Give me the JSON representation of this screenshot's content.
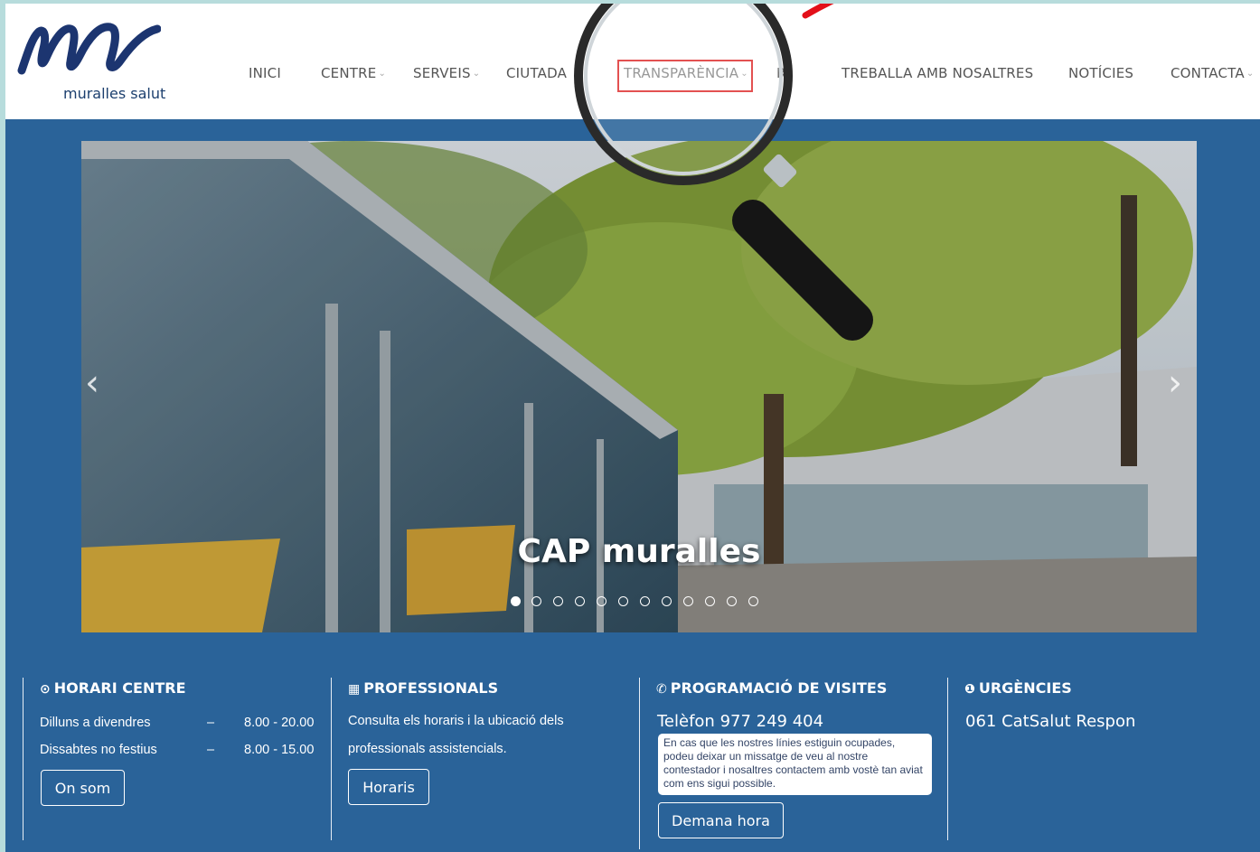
{
  "brand": {
    "logo_text": "muralles salut",
    "accent": "#2a6399",
    "highlight": "#e03a3a"
  },
  "nav": {
    "items": [
      {
        "label": "INICI",
        "caret": false
      },
      {
        "label": "CENTRE",
        "caret": true
      },
      {
        "label": "SERVEIS",
        "caret": true
      },
      {
        "label": "CIUTADA",
        "caret": false
      },
      {
        "label": "TRANSPARÈNCIA",
        "caret": true
      },
      {
        "label": "R",
        "caret": false
      },
      {
        "label": "TREBALLA AMB NOSALTRES",
        "caret": false
      },
      {
        "label": "NOTÍCIES",
        "caret": false
      },
      {
        "label": "CONTACTA",
        "caret": true
      }
    ],
    "caret_glyph": "⌄",
    "highlighted": "TRANSPARÈNCIA"
  },
  "slider": {
    "caption": "CAP muralles",
    "prev_icon": "chevron-left-icon",
    "next_icon": "chevron-right-icon",
    "prev_glyph": "‹",
    "next_glyph": "›",
    "dot_count": 12,
    "active_dot": 1
  },
  "info": {
    "horari": {
      "icon": "clock-icon",
      "icon_glyph": "⊙",
      "title": "HORARI CENTRE",
      "rows": [
        {
          "day": "Dilluns a divendres",
          "sep": "–",
          "hours": "8.00 - 20.00"
        },
        {
          "day": "Dissabtes no festius",
          "sep": "–",
          "hours": "8.00 - 15.00"
        }
      ],
      "button": "On som"
    },
    "professionals": {
      "icon": "calendar-icon",
      "icon_glyph": "▦",
      "title": "PROFESSIONALS",
      "line1": "Consulta els horaris i la ubicació dels",
      "line2": "professionals assistencials.",
      "button": "Horaris"
    },
    "visites": {
      "icon": "phone-icon",
      "icon_glyph": "✆",
      "title": "PROGRAMACIÓ DE VISITES",
      "phone": "Telèfon 977 249 404",
      "note": "En cas que les nostres línies estiguin ocupades, podeu deixar un missatge de veu al nostre contestador i nosaltres contactem amb vostè tan aviat com ens sigui possible.",
      "button": "Demana hora"
    },
    "urgencies": {
      "icon": "alert-icon",
      "icon_glyph": "❶",
      "title": "URGÈNCIES",
      "line": "061 CatSalut Respon"
    }
  }
}
